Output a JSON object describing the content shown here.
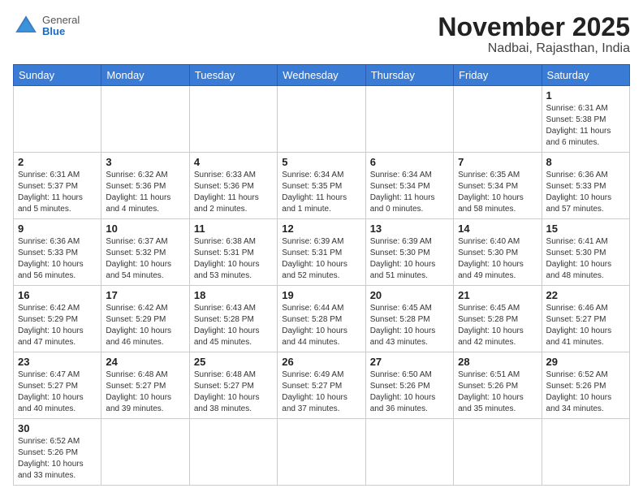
{
  "header": {
    "logo_general": "General",
    "logo_blue": "Blue",
    "month_title": "November 2025",
    "location": "Nadbai, Rajasthan, India"
  },
  "weekdays": [
    "Sunday",
    "Monday",
    "Tuesday",
    "Wednesday",
    "Thursday",
    "Friday",
    "Saturday"
  ],
  "days": [
    {
      "date": "1",
      "info": "Sunrise: 6:31 AM\nSunset: 5:38 PM\nDaylight: 11 hours\nand 6 minutes."
    },
    {
      "date": "2",
      "info": "Sunrise: 6:31 AM\nSunset: 5:37 PM\nDaylight: 11 hours\nand 5 minutes."
    },
    {
      "date": "3",
      "info": "Sunrise: 6:32 AM\nSunset: 5:36 PM\nDaylight: 11 hours\nand 4 minutes."
    },
    {
      "date": "4",
      "info": "Sunrise: 6:33 AM\nSunset: 5:36 PM\nDaylight: 11 hours\nand 2 minutes."
    },
    {
      "date": "5",
      "info": "Sunrise: 6:34 AM\nSunset: 5:35 PM\nDaylight: 11 hours\nand 1 minute."
    },
    {
      "date": "6",
      "info": "Sunrise: 6:34 AM\nSunset: 5:34 PM\nDaylight: 11 hours\nand 0 minutes."
    },
    {
      "date": "7",
      "info": "Sunrise: 6:35 AM\nSunset: 5:34 PM\nDaylight: 10 hours\nand 58 minutes."
    },
    {
      "date": "8",
      "info": "Sunrise: 6:36 AM\nSunset: 5:33 PM\nDaylight: 10 hours\nand 57 minutes."
    },
    {
      "date": "9",
      "info": "Sunrise: 6:36 AM\nSunset: 5:33 PM\nDaylight: 10 hours\nand 56 minutes."
    },
    {
      "date": "10",
      "info": "Sunrise: 6:37 AM\nSunset: 5:32 PM\nDaylight: 10 hours\nand 54 minutes."
    },
    {
      "date": "11",
      "info": "Sunrise: 6:38 AM\nSunset: 5:31 PM\nDaylight: 10 hours\nand 53 minutes."
    },
    {
      "date": "12",
      "info": "Sunrise: 6:39 AM\nSunset: 5:31 PM\nDaylight: 10 hours\nand 52 minutes."
    },
    {
      "date": "13",
      "info": "Sunrise: 6:39 AM\nSunset: 5:30 PM\nDaylight: 10 hours\nand 51 minutes."
    },
    {
      "date": "14",
      "info": "Sunrise: 6:40 AM\nSunset: 5:30 PM\nDaylight: 10 hours\nand 49 minutes."
    },
    {
      "date": "15",
      "info": "Sunrise: 6:41 AM\nSunset: 5:30 PM\nDaylight: 10 hours\nand 48 minutes."
    },
    {
      "date": "16",
      "info": "Sunrise: 6:42 AM\nSunset: 5:29 PM\nDaylight: 10 hours\nand 47 minutes."
    },
    {
      "date": "17",
      "info": "Sunrise: 6:42 AM\nSunset: 5:29 PM\nDaylight: 10 hours\nand 46 minutes."
    },
    {
      "date": "18",
      "info": "Sunrise: 6:43 AM\nSunset: 5:28 PM\nDaylight: 10 hours\nand 45 minutes."
    },
    {
      "date": "19",
      "info": "Sunrise: 6:44 AM\nSunset: 5:28 PM\nDaylight: 10 hours\nand 44 minutes."
    },
    {
      "date": "20",
      "info": "Sunrise: 6:45 AM\nSunset: 5:28 PM\nDaylight: 10 hours\nand 43 minutes."
    },
    {
      "date": "21",
      "info": "Sunrise: 6:45 AM\nSunset: 5:28 PM\nDaylight: 10 hours\nand 42 minutes."
    },
    {
      "date": "22",
      "info": "Sunrise: 6:46 AM\nSunset: 5:27 PM\nDaylight: 10 hours\nand 41 minutes."
    },
    {
      "date": "23",
      "info": "Sunrise: 6:47 AM\nSunset: 5:27 PM\nDaylight: 10 hours\nand 40 minutes."
    },
    {
      "date": "24",
      "info": "Sunrise: 6:48 AM\nSunset: 5:27 PM\nDaylight: 10 hours\nand 39 minutes."
    },
    {
      "date": "25",
      "info": "Sunrise: 6:48 AM\nSunset: 5:27 PM\nDaylight: 10 hours\nand 38 minutes."
    },
    {
      "date": "26",
      "info": "Sunrise: 6:49 AM\nSunset: 5:27 PM\nDaylight: 10 hours\nand 37 minutes."
    },
    {
      "date": "27",
      "info": "Sunrise: 6:50 AM\nSunset: 5:26 PM\nDaylight: 10 hours\nand 36 minutes."
    },
    {
      "date": "28",
      "info": "Sunrise: 6:51 AM\nSunset: 5:26 PM\nDaylight: 10 hours\nand 35 minutes."
    },
    {
      "date": "29",
      "info": "Sunrise: 6:52 AM\nSunset: 5:26 PM\nDaylight: 10 hours\nand 34 minutes."
    },
    {
      "date": "30",
      "info": "Sunrise: 6:52 AM\nSunset: 5:26 PM\nDaylight: 10 hours\nand 33 minutes."
    }
  ]
}
